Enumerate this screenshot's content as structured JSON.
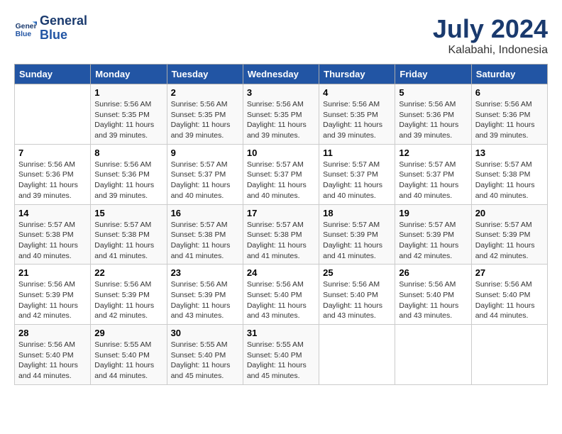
{
  "logo": {
    "line1": "General",
    "line2": "Blue"
  },
  "title": "July 2024",
  "subtitle": "Kalabahi, Indonesia",
  "weekdays": [
    "Sunday",
    "Monday",
    "Tuesday",
    "Wednesday",
    "Thursday",
    "Friday",
    "Saturday"
  ],
  "weeks": [
    [
      {
        "day": "",
        "sunrise": "",
        "sunset": "",
        "daylight": ""
      },
      {
        "day": "1",
        "sunrise": "Sunrise: 5:56 AM",
        "sunset": "Sunset: 5:35 PM",
        "daylight": "Daylight: 11 hours and 39 minutes."
      },
      {
        "day": "2",
        "sunrise": "Sunrise: 5:56 AM",
        "sunset": "Sunset: 5:35 PM",
        "daylight": "Daylight: 11 hours and 39 minutes."
      },
      {
        "day": "3",
        "sunrise": "Sunrise: 5:56 AM",
        "sunset": "Sunset: 5:35 PM",
        "daylight": "Daylight: 11 hours and 39 minutes."
      },
      {
        "day": "4",
        "sunrise": "Sunrise: 5:56 AM",
        "sunset": "Sunset: 5:35 PM",
        "daylight": "Daylight: 11 hours and 39 minutes."
      },
      {
        "day": "5",
        "sunrise": "Sunrise: 5:56 AM",
        "sunset": "Sunset: 5:36 PM",
        "daylight": "Daylight: 11 hours and 39 minutes."
      },
      {
        "day": "6",
        "sunrise": "Sunrise: 5:56 AM",
        "sunset": "Sunset: 5:36 PM",
        "daylight": "Daylight: 11 hours and 39 minutes."
      }
    ],
    [
      {
        "day": "7",
        "sunrise": "Sunrise: 5:56 AM",
        "sunset": "Sunset: 5:36 PM",
        "daylight": "Daylight: 11 hours and 39 minutes."
      },
      {
        "day": "8",
        "sunrise": "Sunrise: 5:56 AM",
        "sunset": "Sunset: 5:36 PM",
        "daylight": "Daylight: 11 hours and 39 minutes."
      },
      {
        "day": "9",
        "sunrise": "Sunrise: 5:57 AM",
        "sunset": "Sunset: 5:37 PM",
        "daylight": "Daylight: 11 hours and 40 minutes."
      },
      {
        "day": "10",
        "sunrise": "Sunrise: 5:57 AM",
        "sunset": "Sunset: 5:37 PM",
        "daylight": "Daylight: 11 hours and 40 minutes."
      },
      {
        "day": "11",
        "sunrise": "Sunrise: 5:57 AM",
        "sunset": "Sunset: 5:37 PM",
        "daylight": "Daylight: 11 hours and 40 minutes."
      },
      {
        "day": "12",
        "sunrise": "Sunrise: 5:57 AM",
        "sunset": "Sunset: 5:37 PM",
        "daylight": "Daylight: 11 hours and 40 minutes."
      },
      {
        "day": "13",
        "sunrise": "Sunrise: 5:57 AM",
        "sunset": "Sunset: 5:38 PM",
        "daylight": "Daylight: 11 hours and 40 minutes."
      }
    ],
    [
      {
        "day": "14",
        "sunrise": "Sunrise: 5:57 AM",
        "sunset": "Sunset: 5:38 PM",
        "daylight": "Daylight: 11 hours and 40 minutes."
      },
      {
        "day": "15",
        "sunrise": "Sunrise: 5:57 AM",
        "sunset": "Sunset: 5:38 PM",
        "daylight": "Daylight: 11 hours and 41 minutes."
      },
      {
        "day": "16",
        "sunrise": "Sunrise: 5:57 AM",
        "sunset": "Sunset: 5:38 PM",
        "daylight": "Daylight: 11 hours and 41 minutes."
      },
      {
        "day": "17",
        "sunrise": "Sunrise: 5:57 AM",
        "sunset": "Sunset: 5:38 PM",
        "daylight": "Daylight: 11 hours and 41 minutes."
      },
      {
        "day": "18",
        "sunrise": "Sunrise: 5:57 AM",
        "sunset": "Sunset: 5:39 PM",
        "daylight": "Daylight: 11 hours and 41 minutes."
      },
      {
        "day": "19",
        "sunrise": "Sunrise: 5:57 AM",
        "sunset": "Sunset: 5:39 PM",
        "daylight": "Daylight: 11 hours and 42 minutes."
      },
      {
        "day": "20",
        "sunrise": "Sunrise: 5:57 AM",
        "sunset": "Sunset: 5:39 PM",
        "daylight": "Daylight: 11 hours and 42 minutes."
      }
    ],
    [
      {
        "day": "21",
        "sunrise": "Sunrise: 5:56 AM",
        "sunset": "Sunset: 5:39 PM",
        "daylight": "Daylight: 11 hours and 42 minutes."
      },
      {
        "day": "22",
        "sunrise": "Sunrise: 5:56 AM",
        "sunset": "Sunset: 5:39 PM",
        "daylight": "Daylight: 11 hours and 42 minutes."
      },
      {
        "day": "23",
        "sunrise": "Sunrise: 5:56 AM",
        "sunset": "Sunset: 5:39 PM",
        "daylight": "Daylight: 11 hours and 43 minutes."
      },
      {
        "day": "24",
        "sunrise": "Sunrise: 5:56 AM",
        "sunset": "Sunset: 5:40 PM",
        "daylight": "Daylight: 11 hours and 43 minutes."
      },
      {
        "day": "25",
        "sunrise": "Sunrise: 5:56 AM",
        "sunset": "Sunset: 5:40 PM",
        "daylight": "Daylight: 11 hours and 43 minutes."
      },
      {
        "day": "26",
        "sunrise": "Sunrise: 5:56 AM",
        "sunset": "Sunset: 5:40 PM",
        "daylight": "Daylight: 11 hours and 43 minutes."
      },
      {
        "day": "27",
        "sunrise": "Sunrise: 5:56 AM",
        "sunset": "Sunset: 5:40 PM",
        "daylight": "Daylight: 11 hours and 44 minutes."
      }
    ],
    [
      {
        "day": "28",
        "sunrise": "Sunrise: 5:56 AM",
        "sunset": "Sunset: 5:40 PM",
        "daylight": "Daylight: 11 hours and 44 minutes."
      },
      {
        "day": "29",
        "sunrise": "Sunrise: 5:55 AM",
        "sunset": "Sunset: 5:40 PM",
        "daylight": "Daylight: 11 hours and 44 minutes."
      },
      {
        "day": "30",
        "sunrise": "Sunrise: 5:55 AM",
        "sunset": "Sunset: 5:40 PM",
        "daylight": "Daylight: 11 hours and 45 minutes."
      },
      {
        "day": "31",
        "sunrise": "Sunrise: 5:55 AM",
        "sunset": "Sunset: 5:40 PM",
        "daylight": "Daylight: 11 hours and 45 minutes."
      },
      {
        "day": "",
        "sunrise": "",
        "sunset": "",
        "daylight": ""
      },
      {
        "day": "",
        "sunrise": "",
        "sunset": "",
        "daylight": ""
      },
      {
        "day": "",
        "sunrise": "",
        "sunset": "",
        "daylight": ""
      }
    ]
  ]
}
